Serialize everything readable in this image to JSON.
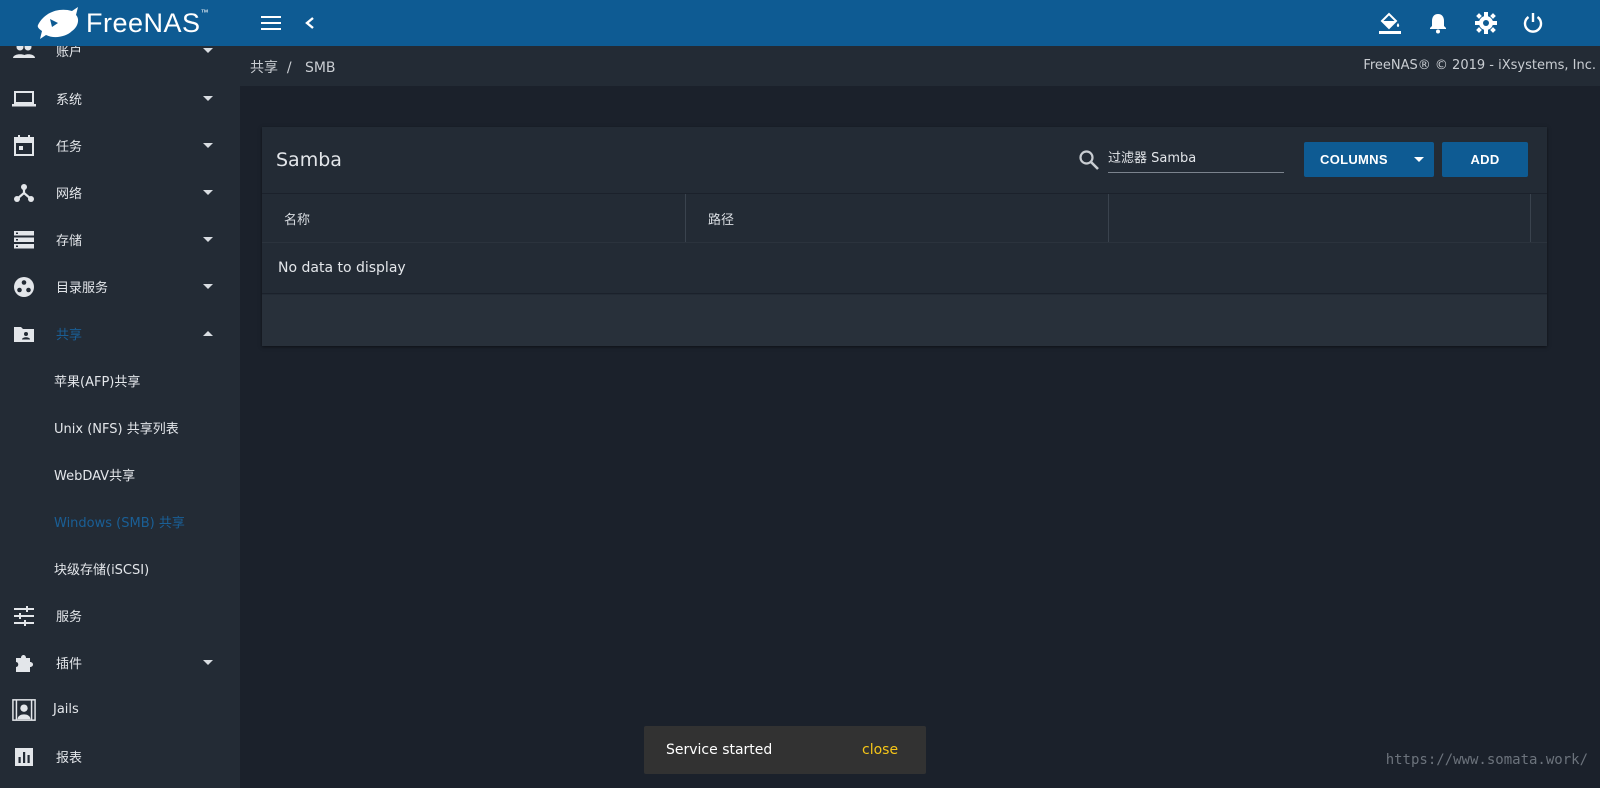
{
  "brand": {
    "name": "FreeNAS",
    "tm": "™"
  },
  "colors": {
    "topbar": "#0e5b93",
    "sidebar": "#232b35",
    "content_bg": "#1b212b",
    "accent": "#1a5f96",
    "snack_action": "#f5c518"
  },
  "breadcrumb": {
    "text": "共享  /   SMB"
  },
  "copyright": "FreeNAS® © 2019 - iXsystems, Inc.",
  "sidebar": {
    "items": [
      {
        "label": "账户",
        "icon": "group-icon"
      },
      {
        "label": "系统",
        "icon": "laptop-icon"
      },
      {
        "label": "任务",
        "icon": "calendar-icon"
      },
      {
        "label": "网络",
        "icon": "network-icon"
      },
      {
        "label": "存储",
        "icon": "storage-icon"
      },
      {
        "label": "目录服务",
        "icon": "directory-icon"
      },
      {
        "label": "共享",
        "icon": "folder-share-icon"
      },
      {
        "label": "服务",
        "icon": "tune-icon"
      },
      {
        "label": "插件",
        "icon": "puzzle-icon"
      },
      {
        "label": "Jails",
        "icon": "jail-icon"
      },
      {
        "label": "报表",
        "icon": "chart-icon"
      }
    ],
    "sub_items": [
      {
        "label": "苹果(AFP)共享"
      },
      {
        "label": "Unix (NFS) 共享列表"
      },
      {
        "label": "WebDAV共享"
      },
      {
        "label": "Windows (SMB) 共享"
      },
      {
        "label": "块级存储(iSCSI)"
      }
    ]
  },
  "card": {
    "title": "Samba",
    "search_placeholder": "过滤器 Samba",
    "columns_label": "COLUMNS",
    "add_label": "ADD",
    "headers": [
      "名称",
      "路径",
      ""
    ],
    "empty_text": "No data to display"
  },
  "snackbar": {
    "message": "Service started",
    "action": "close"
  },
  "watermark": "https://www.somata.work/"
}
